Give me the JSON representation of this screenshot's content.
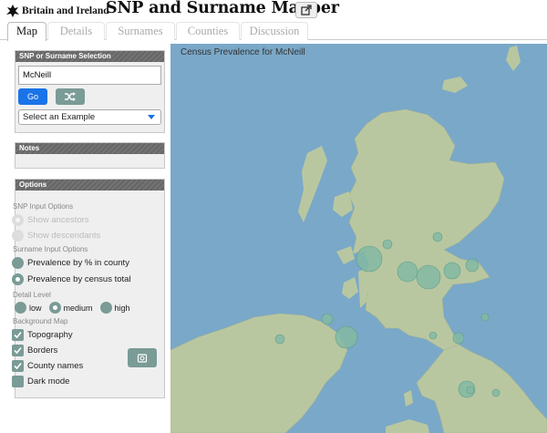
{
  "header": {
    "brand_small": "Britain and Ireland",
    "brand_big": "SNP and Surname Mapper",
    "logo_icon": "gaelic-figure-icon",
    "external_link_icon": "external-link-icon"
  },
  "tabs": [
    {
      "label": "Map",
      "active": true
    },
    {
      "label": "Details",
      "active": false
    },
    {
      "label": "Surnames",
      "active": false
    },
    {
      "label": "Counties",
      "active": false
    },
    {
      "label": "Discussion",
      "active": false
    }
  ],
  "selection_panel": {
    "title": "SNP or Surname Selection",
    "input_value": "McNeill",
    "go_label": "Go",
    "shuffle_icon": "shuffle-icon",
    "example_select": "Select an Example"
  },
  "notes_panel": {
    "title": "Notes"
  },
  "options_panel": {
    "title": "Options",
    "snp_heading": "SNP Input Options",
    "show_ancestors": "Show ancestors",
    "show_descendants": "Show descendants",
    "surname_heading": "Surname Input Options",
    "prev_county": "Prevalence by % in county",
    "prev_census": "Prevalence by census total",
    "detail_heading": "Detail Level",
    "detail_low": "low",
    "detail_medium": "medium",
    "detail_high": "high",
    "bg_heading": "Background Map",
    "topography": "Topography",
    "borders": "Borders",
    "county_names": "County names",
    "dark_mode": "Dark mode",
    "refresh_icon": "refresh-map-icon"
  },
  "map": {
    "title": "Census Prevalence for McNeill"
  },
  "colors": {
    "accent_blue": "#1a73e8",
    "teal": "#7a9b96",
    "sea": "#7aa8c8",
    "land": "#b9c7a1",
    "marker": "#82b9a3"
  }
}
